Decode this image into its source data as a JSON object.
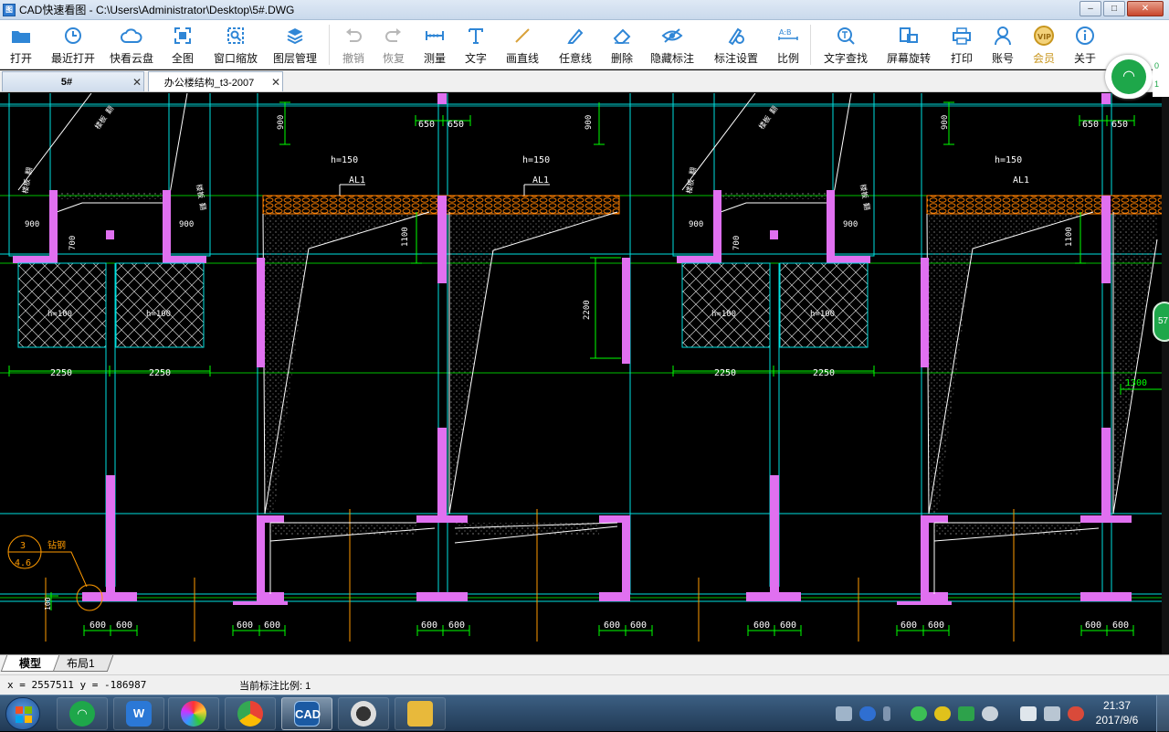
{
  "window": {
    "title": "CAD快速看图 - C:\\Users\\Administrator\\Desktop\\5#.DWG",
    "app_icon_text": "图",
    "minimize": "‒",
    "maximize": "□",
    "close": "✕"
  },
  "toolbar": {
    "open": "打开",
    "recent": "最近打开",
    "cloud": "快看云盘",
    "full_view": "全图",
    "window_zoom": "窗口缩放",
    "layers": "图层管理",
    "undo": "撤销",
    "redo": "恢复",
    "measure": "测量",
    "text": "文字",
    "line": "画直线",
    "freehand": "任意线",
    "delete": "删除",
    "hide_annot": "隐藏标注",
    "annot_settings": "标注设置",
    "scale": "比例",
    "text_search": "文字查找",
    "rotate": "屏幕旋转",
    "print": "打印",
    "account": "账号",
    "vip": "会员",
    "about": "关于"
  },
  "icons": {
    "open": "folder-icon",
    "recent": "clock-icon",
    "cloud": "cloud-icon",
    "full_view": "fullscreen-icon",
    "window_zoom": "zoom-window-icon",
    "layers": "layers-icon",
    "undo": "undo-icon",
    "redo": "redo-icon",
    "measure": "ruler-icon",
    "text": "text-icon",
    "line": "line-icon",
    "freehand": "pen-icon",
    "delete": "eraser-icon",
    "hide_annot": "eye-icon",
    "annot_settings": "settings-icon",
    "scale": "scale-icon",
    "text_search": "text-search-icon",
    "rotate": "rotate-icon",
    "print": "printer-icon",
    "account": "user-icon",
    "vip": "vip-icon",
    "about": "info-icon"
  },
  "tabs": [
    {
      "label": "5#",
      "active": true
    },
    {
      "label": "办公楼结构_t3-2007",
      "active": false
    }
  ],
  "tab_close": "✕",
  "drawing": {
    "labels": {
      "h150": "h=150",
      "h100": "h=100",
      "al1": "AL1",
      "d650": "650",
      "d900": "900",
      "d700": "700",
      "d1100": "1100",
      "d2200": "2200",
      "d2250": "2250",
      "d600": "600",
      "d1300": "1300",
      "d100": "100",
      "detail_ref_top": "3",
      "detail_ref_bottom": "4.6",
      "detail_note": "钻钢",
      "wall_label": "楼板 翻",
      "wall_label_b": "楼板 翻"
    }
  },
  "layout_tabs": {
    "model": "模型",
    "layout1": "布局1"
  },
  "status": {
    "coords": "x = 2557511  y = -186987",
    "scale": "当前标注比例: 1"
  },
  "net_widget": {
    "side_top": "0",
    "side_bottom": "1"
  },
  "pct_widget": "57",
  "taskbar": {
    "time": "21:37",
    "date": "2017/9/6",
    "cad_label": "CAD"
  },
  "colors": {
    "wall_fill": "#e070f0",
    "dim_green": "#00ff00",
    "outline_cyan": "#00e0e0",
    "hatch_orange": "#ff8000",
    "grid_orange": "#ff9a00",
    "text_white": "#ffffff"
  }
}
